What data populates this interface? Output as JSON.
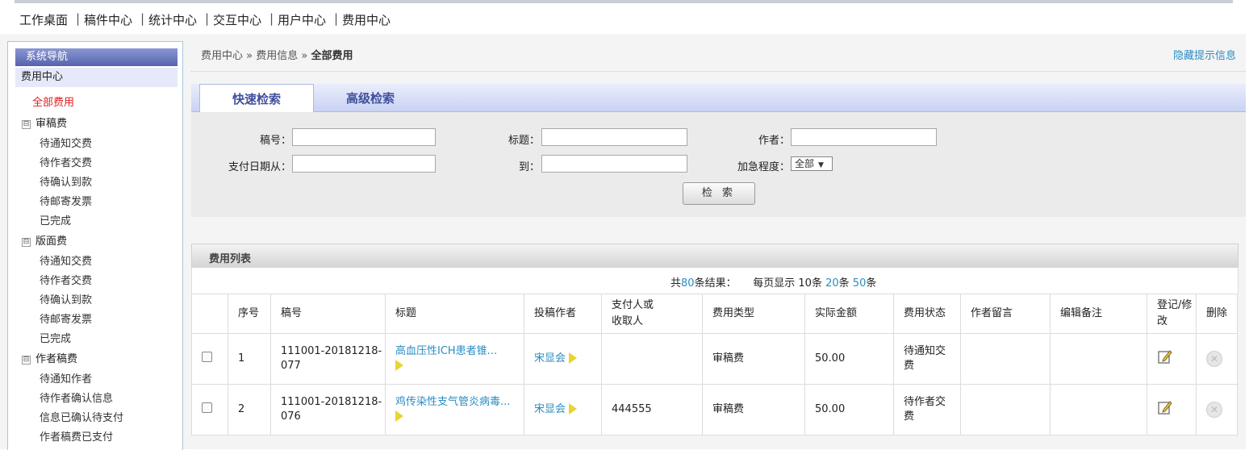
{
  "top_nav": {
    "items": [
      "工作桌面",
      "稿件中心",
      "统计中心",
      "交互中心",
      "用户中心",
      "费用中心"
    ],
    "separator": "|"
  },
  "sidebar": {
    "title": "系统导航",
    "section": "费用中心",
    "active_item": "全部费用",
    "groups": [
      {
        "toggle": "⊟",
        "label": "审稿费",
        "items": [
          "待通知交费",
          "待作者交费",
          "待确认到款",
          "待邮寄发票",
          "已完成"
        ]
      },
      {
        "toggle": "⊟",
        "label": "版面费",
        "items": [
          "待通知交费",
          "待作者交费",
          "待确认到款",
          "待邮寄发票",
          "已完成"
        ]
      },
      {
        "toggle": "⊟",
        "label": "作者稿费",
        "items": [
          "待通知作者",
          "待作者确认信息",
          "信息已确认待支付",
          "作者稿费已支付"
        ]
      }
    ]
  },
  "breadcrumb": {
    "parts": [
      "费用中心",
      "费用信息",
      "全部费用"
    ],
    "separator": "»"
  },
  "hide_tips": "隐藏提示信息",
  "tabs": {
    "quick": "快速检索",
    "advanced": "高级检索"
  },
  "search": {
    "manuscript_no": "稿号：",
    "title": "标题：",
    "author": "作者：",
    "pay_date_from": "支付日期从：",
    "to": "到：",
    "urgency": "加急程度：",
    "urgency_value": "全部",
    "button": "检 索"
  },
  "list": {
    "header": "费用列表",
    "pager": {
      "total_prefix": "共",
      "total": "80",
      "total_suffix": "条结果：",
      "per_page_prefix": "每页显示",
      "opt1": "10条",
      "opt2": "20",
      "opt3": "50",
      "unit": "条"
    },
    "columns": [
      "序号",
      "稿号",
      "标题",
      "投稿作者",
      "支付人或收取人",
      "费用类型",
      "实际金额",
      "费用状态",
      "作者留言",
      "编辑备注",
      "登记/修改",
      "删除"
    ],
    "columns_display": {
      "payer_line1": "支付人或",
      "payer_line2": "收取人",
      "edit_line1": "登记/修",
      "edit_line2": "改"
    },
    "rows": [
      {
        "seq": "1",
        "no_line1": "111001-20181218-",
        "no_line2": "077",
        "title": "高血压性ICH患者锥...",
        "author": "宋显会",
        "payer": "",
        "fee_type": "审稿费",
        "amount": "50.00",
        "status_line1": "待通知交",
        "status_line2": "费",
        "author_note": "",
        "editor_note": ""
      },
      {
        "seq": "2",
        "no_line1": "111001-20181218-",
        "no_line2": "076",
        "title": "鸡传染性支气管炎病毒...",
        "author": "宋显会",
        "payer": "444555",
        "fee_type": "审稿费",
        "amount": "50.00",
        "status_line1": "待作者交",
        "status_line2": "费",
        "author_note": "",
        "editor_note": ""
      }
    ]
  }
}
